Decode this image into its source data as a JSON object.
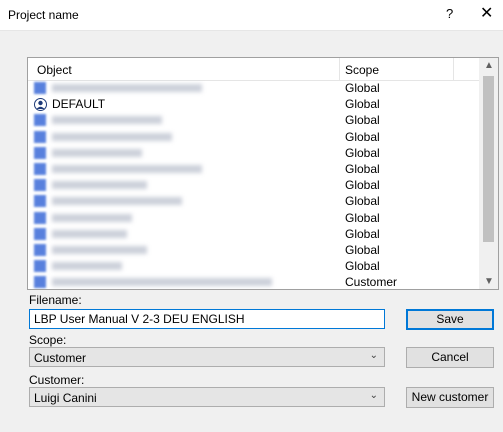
{
  "window": {
    "title": "Project name",
    "help_glyph": "?",
    "close_glyph": "✕"
  },
  "list": {
    "columns": {
      "object": "Object",
      "scope": "Scope"
    },
    "rows": [
      {
        "name": "",
        "scope": "Global",
        "blurred": true,
        "icon": "object-icon"
      },
      {
        "name": "DEFAULT",
        "scope": "Global",
        "blurred": false,
        "icon": "user-icon"
      },
      {
        "name": "",
        "scope": "Global",
        "blurred": true,
        "icon": "object-icon"
      },
      {
        "name": "",
        "scope": "Global",
        "blurred": true,
        "icon": "object-icon"
      },
      {
        "name": "",
        "scope": "Global",
        "blurred": true,
        "icon": "object-icon"
      },
      {
        "name": "",
        "scope": "Global",
        "blurred": true,
        "icon": "object-icon"
      },
      {
        "name": "",
        "scope": "Global",
        "blurred": true,
        "icon": "object-icon"
      },
      {
        "name": "",
        "scope": "Global",
        "blurred": true,
        "icon": "object-icon"
      },
      {
        "name": "",
        "scope": "Global",
        "blurred": true,
        "icon": "object-icon"
      },
      {
        "name": "",
        "scope": "Global",
        "blurred": true,
        "icon": "object-icon"
      },
      {
        "name": "",
        "scope": "Global",
        "blurred": true,
        "icon": "object-icon"
      },
      {
        "name": "",
        "scope": "Global",
        "blurred": true,
        "icon": "object-icon"
      },
      {
        "name": "",
        "scope": "Customer",
        "blurred": true,
        "icon": "object-icon"
      }
    ]
  },
  "filename": {
    "label": "Filename:",
    "value": "LBP User Manual V 2-3 DEU ENGLISH"
  },
  "scope": {
    "label": "Scope:",
    "value": "Customer"
  },
  "customer": {
    "label": "Customer:",
    "value": "Luigi Canini"
  },
  "buttons": {
    "save": "Save",
    "cancel": "Cancel",
    "new_customer": "New customer"
  },
  "colors": {
    "accent": "#0078d7",
    "blur_icon": "#3c6bd8"
  }
}
